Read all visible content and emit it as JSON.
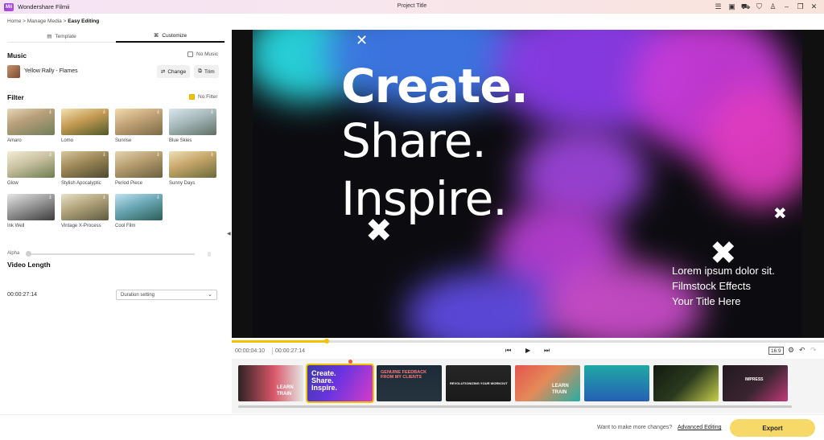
{
  "app": {
    "logo_text": "Mii",
    "name": "Wondershare Filmii",
    "project_title": "Project Title"
  },
  "titlebar_icons": [
    "menu-icon",
    "save-icon",
    "cart-icon",
    "shirt-icon",
    "user-icon",
    "minimize-icon",
    "restore-icon",
    "close-icon"
  ],
  "breadcrumb": {
    "home": "Home",
    "sep": ">",
    "media": "Manage Media",
    "current": "Easy Editing"
  },
  "tabs": [
    {
      "label": "Template",
      "icon": "template-icon"
    },
    {
      "label": "Customize",
      "icon": "customize-icon",
      "active": true
    }
  ],
  "music": {
    "title": "Music",
    "no_music_label": "No Music",
    "no_music_checked": false,
    "track_name": "Yellow Rally - Flames",
    "change_label": "Change",
    "trim_label": "Trim"
  },
  "filter": {
    "title": "Filter",
    "no_filter_label": "No Filter",
    "no_filter_checked": true,
    "items": [
      {
        "label": "Amaro"
      },
      {
        "label": "Lomo"
      },
      {
        "label": "Sunrise"
      },
      {
        "label": "Blue Skies"
      },
      {
        "label": "Glow"
      },
      {
        "label": "Stylish Apocalyptic"
      },
      {
        "label": "Period Piece"
      },
      {
        "label": "Sunny Days"
      },
      {
        "label": "Ink Well"
      },
      {
        "label": "Vintage X-Process"
      },
      {
        "label": "Cool Film"
      }
    ],
    "alpha_label": "Alpha",
    "alpha_value": 0
  },
  "video_length": {
    "title": "Video Length",
    "value": "00:00:27:14",
    "select_value": "Duration setting"
  },
  "preview": {
    "line1": "Create.",
    "line2": "Share.",
    "line3": "Inspire.",
    "lorem1": "Lorem ipsum dolor sit.",
    "lorem2": "Filmstock Effects",
    "lorem3": "Your Title Here"
  },
  "playback": {
    "current_time": "00:00:04:10",
    "total_time": "00:00:27:14",
    "progress": 0.16,
    "aspect_ratio": "16:9"
  },
  "clips": [
    {
      "text": "LEARN TRAIN",
      "colors": [
        "#3a2a2a",
        "#e05a6a"
      ]
    },
    {
      "text": "Create. Share. Inspire.",
      "colors": [
        "#5b2bd8",
        "#d63cc8"
      ],
      "selected": true
    },
    {
      "text": "GENUINE FEEDBACK FROM MY CLIENTS",
      "colors": [
        "#1f2f3a",
        "#e75b63"
      ]
    },
    {
      "text": "REVOLUTIONIZING YOUR WORKOUT",
      "colors": [
        "#202020",
        "#3a3a3a"
      ]
    },
    {
      "text": "LEARN TRAIN",
      "colors": [
        "#e6554f",
        "#2ab0a8"
      ]
    },
    {
      "text": "",
      "colors": [
        "#1fa3a6",
        "#2563b5"
      ]
    },
    {
      "text": "",
      "colors": [
        "#1a2414",
        "#c9d04a"
      ]
    },
    {
      "text": "IMPRESS",
      "colors": [
        "#2a1b24",
        "#c03a7a"
      ]
    }
  ],
  "footer": {
    "hint": "Want to make more changes?",
    "advanced_label": "Advanced Editing",
    "export_label": "Export"
  },
  "colors": {
    "accent": "#f2c200",
    "export_bg": "#f7d96a",
    "active_tab": "#111111"
  }
}
